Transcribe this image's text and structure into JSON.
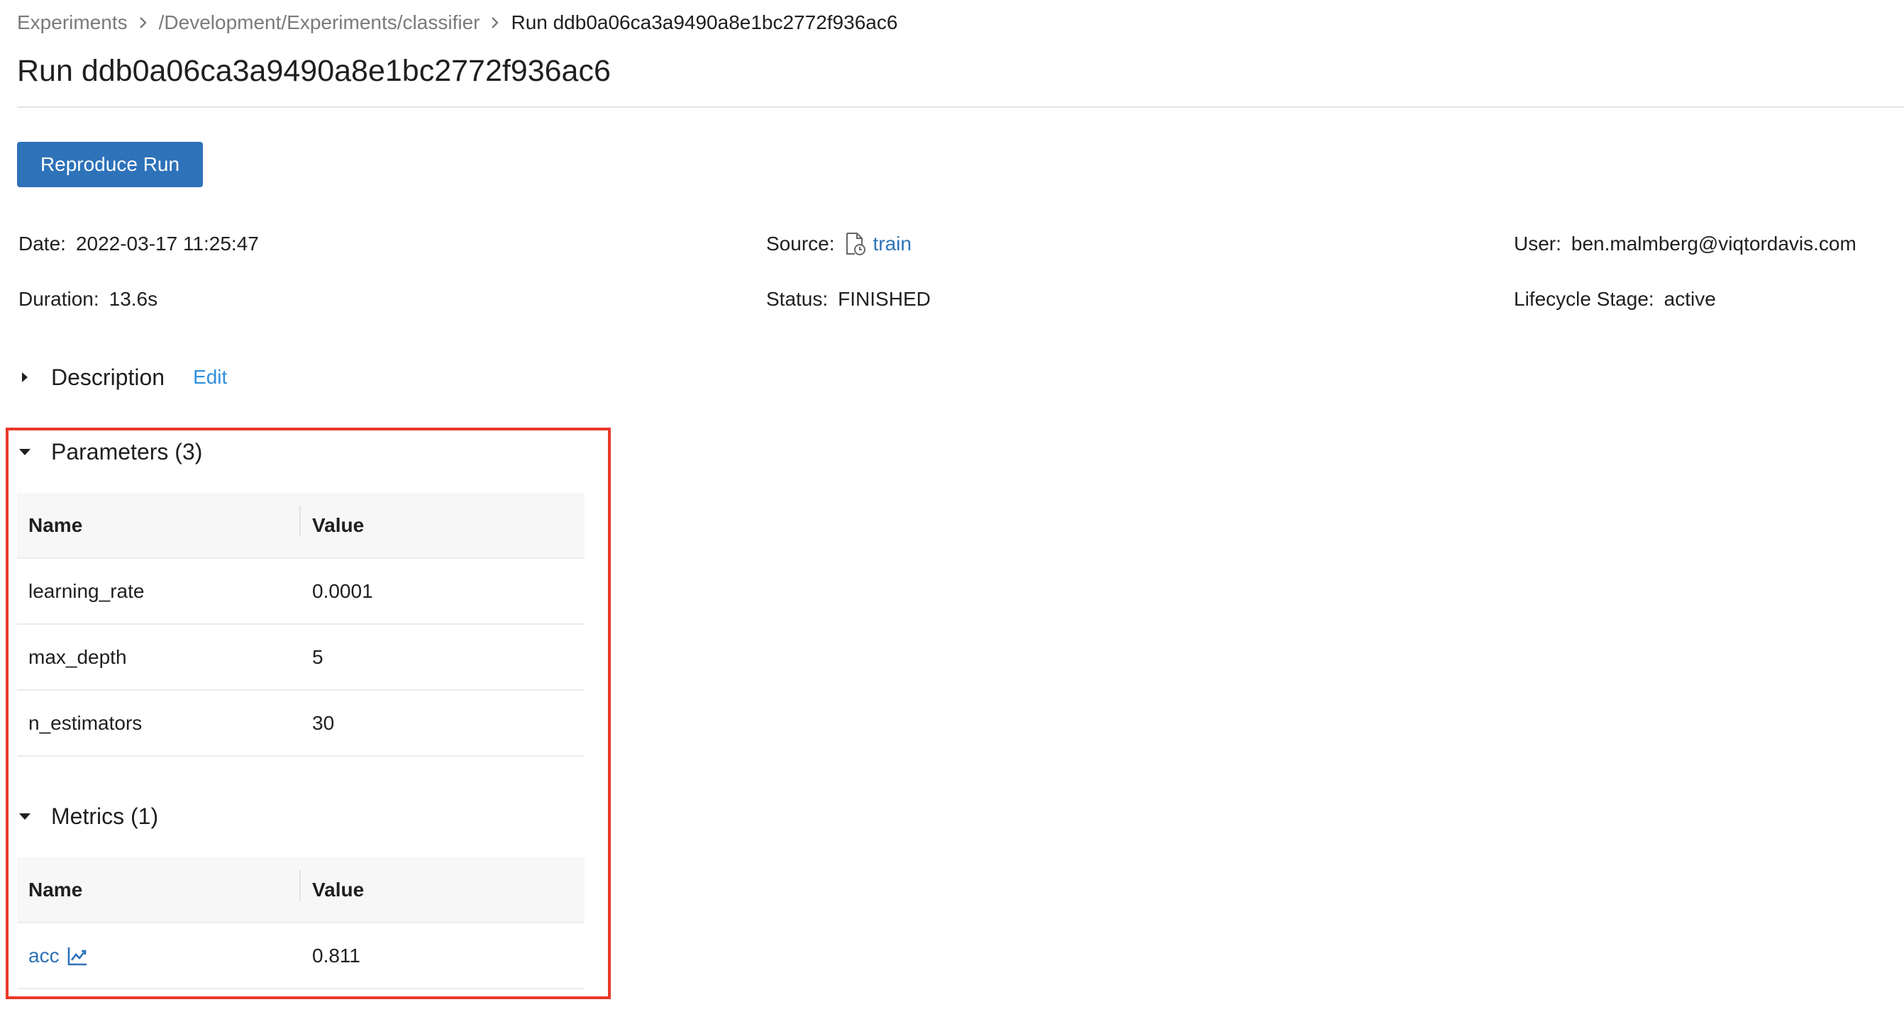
{
  "breadcrumb": {
    "items": [
      "Experiments",
      "/Development/Experiments/classifier"
    ],
    "current": "Run ddb0a06ca3a9490a8e1bc2772f936ac6"
  },
  "title": "Run ddb0a06ca3a9490a8e1bc2772f936ac6",
  "reproduce_button": "Reproduce Run",
  "summary": {
    "date": {
      "label": "Date",
      "value": "2022-03-17 11:25:47"
    },
    "source": {
      "label": "Source",
      "value": "train"
    },
    "user": {
      "label": "User",
      "value": "ben.malmberg@viqtordavis.com"
    },
    "duration": {
      "label": "Duration",
      "value": "13.6s"
    },
    "status": {
      "label": "Status",
      "value": "FINISHED"
    },
    "lifecycle": {
      "label": "Lifecycle Stage",
      "value": "active"
    }
  },
  "description": {
    "label": "Description",
    "edit": "Edit"
  },
  "parameters": {
    "label": "Parameters (3)",
    "columns": [
      "Name",
      "Value"
    ],
    "rows": [
      {
        "name": "learning_rate",
        "value": "0.0001"
      },
      {
        "name": "max_depth",
        "value": "5"
      },
      {
        "name": "n_estimators",
        "value": "30"
      }
    ]
  },
  "metrics": {
    "label": "Metrics (1)",
    "columns": [
      "Name",
      "Value"
    ],
    "rows": [
      {
        "name": "acc",
        "value": "0.811"
      }
    ]
  },
  "colors": {
    "primary": "#2e72b9",
    "link": "#2e8fe0",
    "highlight": "#e8392a"
  }
}
